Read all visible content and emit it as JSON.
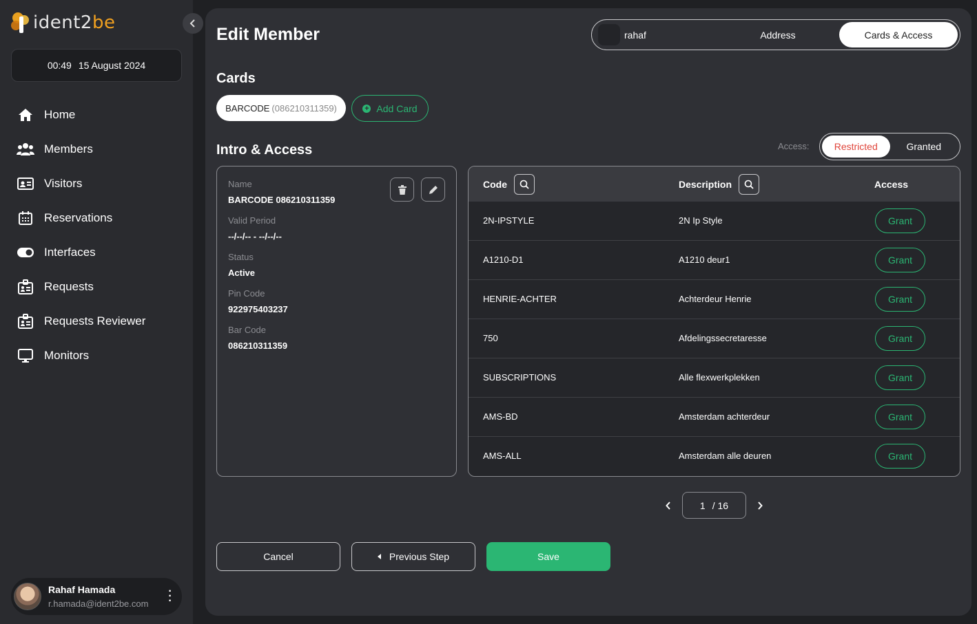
{
  "app": {
    "logo_text": "ident2be",
    "logo_prefix": "ident2",
    "logo_suffix": "be"
  },
  "clock": {
    "time": "00:49",
    "date": "15 August 2024"
  },
  "sidebar": {
    "items": [
      {
        "label": "Home",
        "icon": "home-icon"
      },
      {
        "label": "Members",
        "icon": "members-icon"
      },
      {
        "label": "Visitors",
        "icon": "id-card-icon"
      },
      {
        "label": "Reservations",
        "icon": "calendar-icon"
      },
      {
        "label": "Interfaces",
        "icon": "toggle-icon"
      },
      {
        "label": "Requests",
        "icon": "badge-icon"
      },
      {
        "label": "Requests Reviewer",
        "icon": "badge-icon"
      },
      {
        "label": "Monitors",
        "icon": "monitor-icon"
      }
    ]
  },
  "user": {
    "name": "Rahaf Hamada",
    "email": "r.hamada@ident2be.com"
  },
  "page": {
    "title": "Edit Member"
  },
  "steps": [
    {
      "label": "rahaf",
      "active": false
    },
    {
      "label": "Address",
      "active": false
    },
    {
      "label": "Cards & Access",
      "active": true
    }
  ],
  "cards": {
    "title": "Cards",
    "card_type": "BARCODE",
    "card_number": "(086210311359)",
    "add_label": "Add Card"
  },
  "intro": {
    "title": "Intro & Access",
    "access_label": "Access:",
    "restricted_label": "Restricted",
    "granted_label": "Granted",
    "selected": "Restricted"
  },
  "card_detail": {
    "fields": [
      {
        "label": "Name",
        "value": "BARCODE 086210311359"
      },
      {
        "label": "Valid Period",
        "value": "--/--/-- - --/--/--"
      },
      {
        "label": "Status",
        "value": "Active"
      },
      {
        "label": "Pin Code",
        "value": "922975403237"
      },
      {
        "label": "Bar Code",
        "value": "086210311359"
      }
    ]
  },
  "table": {
    "headers": {
      "code": "Code",
      "description": "Description",
      "access": "Access"
    },
    "rows": [
      {
        "code": "2N-IPSTYLE",
        "description": "2N Ip Style",
        "action": "Grant"
      },
      {
        "code": "A1210-D1",
        "description": "A1210 deur1",
        "action": "Grant"
      },
      {
        "code": "HENRIE-ACHTER",
        "description": "Achterdeur Henrie",
        "action": "Grant"
      },
      {
        "code": "750",
        "description": "Afdelingssecretaresse",
        "action": "Grant"
      },
      {
        "code": "SUBSCRIPTIONS",
        "description": "Alle flexwerkplekken",
        "action": "Grant"
      },
      {
        "code": "AMS-BD",
        "description": "Amsterdam achterdeur",
        "action": "Grant"
      },
      {
        "code": "AMS-ALL",
        "description": "Amsterdam alle deuren",
        "action": "Grant"
      }
    ]
  },
  "pager": {
    "current": "1",
    "total": "/ 16"
  },
  "actions": {
    "cancel": "Cancel",
    "previous": "Previous Step",
    "save": "Save"
  },
  "colors": {
    "accent_green": "#2bb673",
    "restricted_red": "#e0443a",
    "logo_orange": "#f0a020"
  }
}
